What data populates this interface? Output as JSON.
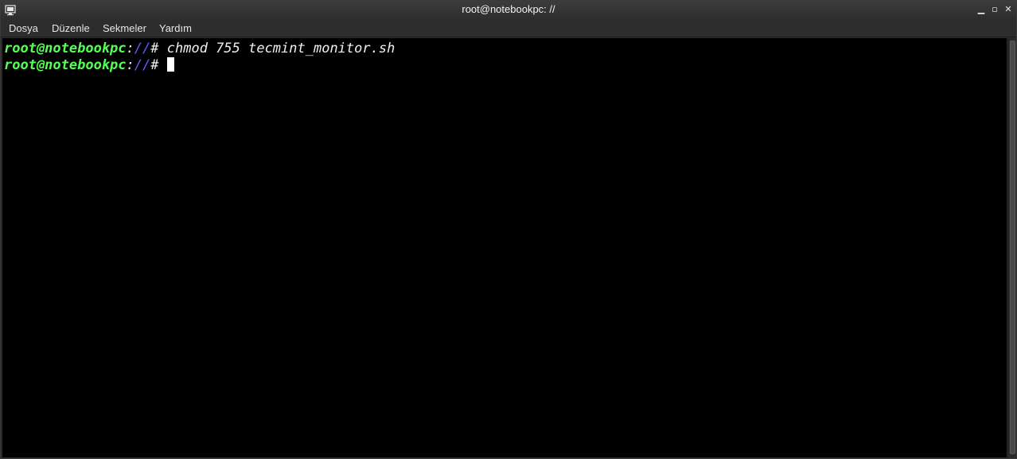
{
  "window": {
    "title": "root@notebookpc: //"
  },
  "titlebar": {
    "icons": [
      "terminal-app-icon",
      "minimize-icon",
      "maximize-icon",
      "close-icon"
    ],
    "minimize_glyph": "▁",
    "maximize_glyph": "▫",
    "close_glyph": "✕"
  },
  "menubar": {
    "items": [
      {
        "label": "Dosya"
      },
      {
        "label": "Düzenle"
      },
      {
        "label": "Sekmeler"
      },
      {
        "label": "Yardım"
      }
    ]
  },
  "terminal": {
    "colors": {
      "background": "#000000",
      "user_host": "#55ff55",
      "path": "#5c5cff",
      "text": "#f0f0f0"
    },
    "lines": [
      {
        "user_host": "root@notebookpc",
        "sep": ":",
        "path": "//",
        "prompt": "# ",
        "command": "chmod 755 tecmint_monitor.sh"
      },
      {
        "user_host": "root@notebookpc",
        "sep": ":",
        "path": "//",
        "prompt": "# ",
        "command": ""
      }
    ]
  }
}
